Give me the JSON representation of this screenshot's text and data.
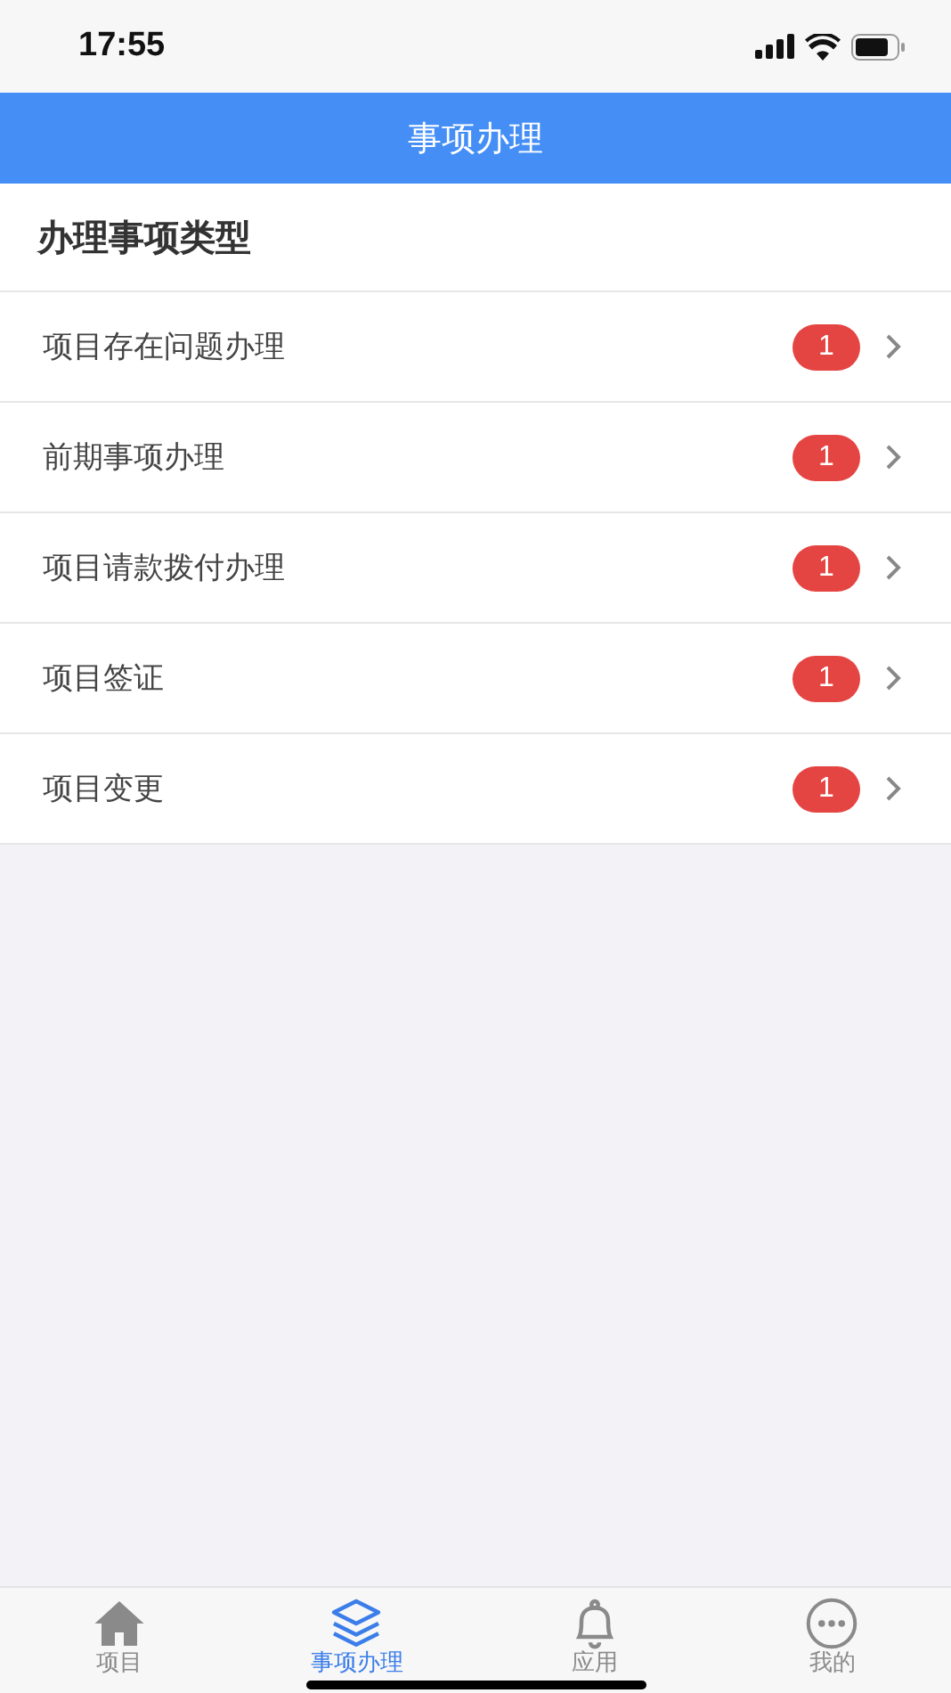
{
  "status_bar": {
    "time": "17:55"
  },
  "nav_bar": {
    "title": "事项办理"
  },
  "section": {
    "title": "办理事项类型"
  },
  "items": [
    {
      "label": "项目存在问题办理",
      "badge": "1"
    },
    {
      "label": "前期事项办理",
      "badge": "1"
    },
    {
      "label": "项目请款拨付办理",
      "badge": "1"
    },
    {
      "label": "项目签证",
      "badge": "1"
    },
    {
      "label": "项目变更",
      "badge": "1"
    }
  ],
  "tab_bar": [
    {
      "label": "项目",
      "kind": "home",
      "selected": false
    },
    {
      "label": "事项办理",
      "kind": "layers",
      "selected": true
    },
    {
      "label": "应用",
      "kind": "bell",
      "selected": false
    },
    {
      "label": "我的",
      "kind": "more",
      "selected": false
    }
  ]
}
